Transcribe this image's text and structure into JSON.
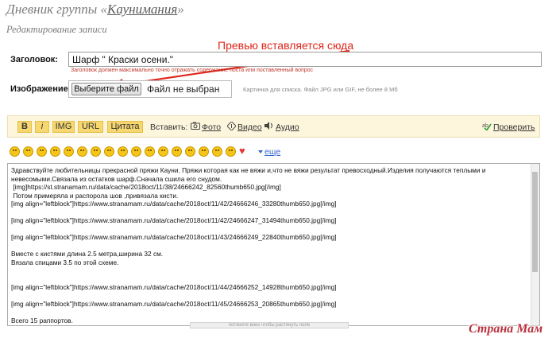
{
  "header": {
    "title_prefix": "Дневник группы «",
    "group_name": "Каунимания",
    "title_suffix": "»",
    "subtitle": "Редактирование записи"
  },
  "annotation": {
    "text": "Превью вставляется сюда",
    "color": "#e0261a"
  },
  "form": {
    "title_label": "Заголовок:",
    "title_value": "Шарф \" Краски осени.\"",
    "title_hint": "Заголовок должен максимально точно отражать содержание поста или поставленный вопрос",
    "image_label": "Изображение:",
    "file_button_label": "Выберите файл",
    "file_status": "Файл не выбран",
    "image_hint": "Картинка для списка. Файл JPG или GIF, не более 8 Мб"
  },
  "toolbar": {
    "bold": "B",
    "italic": "i",
    "img": "IMG",
    "url": "URL",
    "quote": "Цитата",
    "insert_label": "Вставить:",
    "photo": "Фото",
    "video": "Видео",
    "audio": "Аудио",
    "check": "Проверить"
  },
  "smileys": {
    "count": 18,
    "more_label": "еще"
  },
  "editor": {
    "content": "Здравствуйте любительницы прекрасной пряжи Кауни. Пряжи которая как не вяжи и,что не вяжи результат превосходный.Изделия получаются теплыми и невесомыми.Связала из остатков шарф.Сначала сшила его снудом.\n [img]https://st.stranamam.ru/data/cache/2018oct/11/38/24666242_82560thumb650.jpg[/img]\n Потом примеряла и распорола шов ,привязала кисти.\n[img align=\"leftblock\"]https://www.stranamam.ru/data/cache/2018oct/11/42/24666246_33280thumb650.jpg[/img]\n\n[img align=\"leftblock\"]https://www.stranamam.ru/data/cache/2018oct/11/42/24666247_31494thumb650.jpg[/img]\n\n[img align=\"leftblock\"]https://www.stranamam.ru/data/cache/2018oct/11/43/24666249_22840thumb650.jpg[/img]\n\nВместе с кистями длина 2.5 метра,ширина 32 см.\nВязала спицами 3.5 по этой схеме.\n\n\n[img align=\"leftblock\"]https://www.stranamam.ru/data/cache/2018oct/11/44/24666252_14928thumb650.jpg[/img]\n\n[img align=\"leftblock\"]https://www.stranamam.ru/data/cache/2018oct/11/45/24666253_20865thumb650.jpg[/img]\n\nВсего 15 раппортов.",
    "resize_hint": "потяните вниз чтобы растянуть поле"
  },
  "watermark": {
    "text": "Страна Мам"
  },
  "colors": {
    "toolbar_bg": "#fdf6dd",
    "toolbar_button": "#f7d770",
    "link_blue": "#3366cc",
    "hint_red": "#c0392b",
    "smiley_yellow": "#f5c518"
  }
}
